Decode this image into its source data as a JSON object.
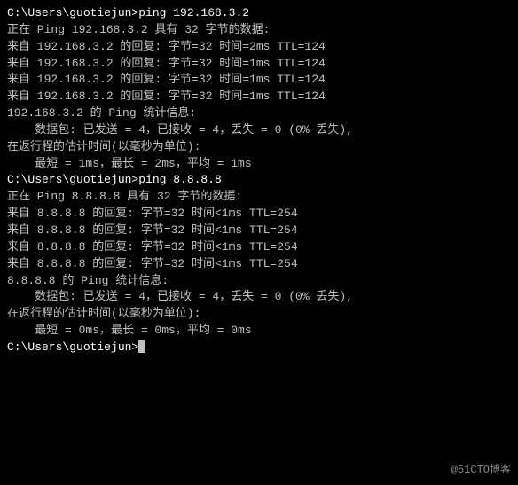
{
  "terminal": {
    "lines": [
      {
        "id": "cmd1",
        "text": "C:\\Users\\guotiejun>ping 192.168.3.2",
        "type": "command"
      },
      {
        "id": "blank1",
        "text": "",
        "type": "blank"
      },
      {
        "id": "ping1_start",
        "text": "正在 Ping 192.168.3.2 具有 32 字节的数据:",
        "type": "normal"
      },
      {
        "id": "ping1_reply1",
        "text": "来自 192.168.3.2 的回复: 字节=32 时间=2ms TTL=124",
        "type": "normal"
      },
      {
        "id": "ping1_reply2",
        "text": "来自 192.168.3.2 的回复: 字节=32 时间=1ms TTL=124",
        "type": "normal"
      },
      {
        "id": "ping1_reply3",
        "text": "来自 192.168.3.2 的回复: 字节=32 时间=1ms TTL=124",
        "type": "normal"
      },
      {
        "id": "ping1_reply4",
        "text": "来自 192.168.3.2 的回复: 字节=32 时间=1ms TTL=124",
        "type": "normal"
      },
      {
        "id": "blank2",
        "text": "",
        "type": "blank"
      },
      {
        "id": "stats1_title",
        "text": "192.168.3.2 的 Ping 统计信息:",
        "type": "normal"
      },
      {
        "id": "stats1_packets",
        "text": "    数据包: 已发送 = 4，已接收 = 4，丢失 = 0 (0% 丢失),",
        "type": "normal"
      },
      {
        "id": "stats1_time",
        "text": "在返行程的估计时间(以毫秒为单位):",
        "type": "normal"
      },
      {
        "id": "stats1_minmax",
        "text": "    最短 = 1ms，最长 = 2ms，平均 = 1ms",
        "type": "normal"
      },
      {
        "id": "blank3",
        "text": "",
        "type": "blank"
      },
      {
        "id": "cmd2",
        "text": "C:\\Users\\guotiejun>ping 8.8.8.8",
        "type": "command"
      },
      {
        "id": "blank4",
        "text": "",
        "type": "blank"
      },
      {
        "id": "ping2_start",
        "text": "正在 Ping 8.8.8.8 具有 32 字节的数据:",
        "type": "normal"
      },
      {
        "id": "ping2_reply1",
        "text": "来自 8.8.8.8 的回复: 字节=32 时间<1ms TTL=254",
        "type": "normal"
      },
      {
        "id": "ping2_reply2",
        "text": "来自 8.8.8.8 的回复: 字节=32 时间<1ms TTL=254",
        "type": "normal"
      },
      {
        "id": "ping2_reply3",
        "text": "来自 8.8.8.8 的回复: 字节=32 时间<1ms TTL=254",
        "type": "normal"
      },
      {
        "id": "ping2_reply4",
        "text": "来自 8.8.8.8 的回复: 字节=32 时间<1ms TTL=254",
        "type": "normal"
      },
      {
        "id": "blank5",
        "text": "",
        "type": "blank"
      },
      {
        "id": "stats2_title",
        "text": "8.8.8.8 的 Ping 统计信息:",
        "type": "normal"
      },
      {
        "id": "stats2_packets",
        "text": "    数据包: 已发送 = 4，已接收 = 4，丢失 = 0 (0% 丢失),",
        "type": "normal"
      },
      {
        "id": "stats2_time",
        "text": "在返行程的估计时间(以毫秒为单位):",
        "type": "normal"
      },
      {
        "id": "stats2_minmax",
        "text": "    最短 = 0ms，最长 = 0ms，平均 = 0ms",
        "type": "normal"
      },
      {
        "id": "blank6",
        "text": "",
        "type": "blank"
      },
      {
        "id": "prompt",
        "text": "C:\\Users\\guotiejun>",
        "type": "command",
        "hasCursor": true
      }
    ],
    "watermark": "@51CTO博客"
  }
}
